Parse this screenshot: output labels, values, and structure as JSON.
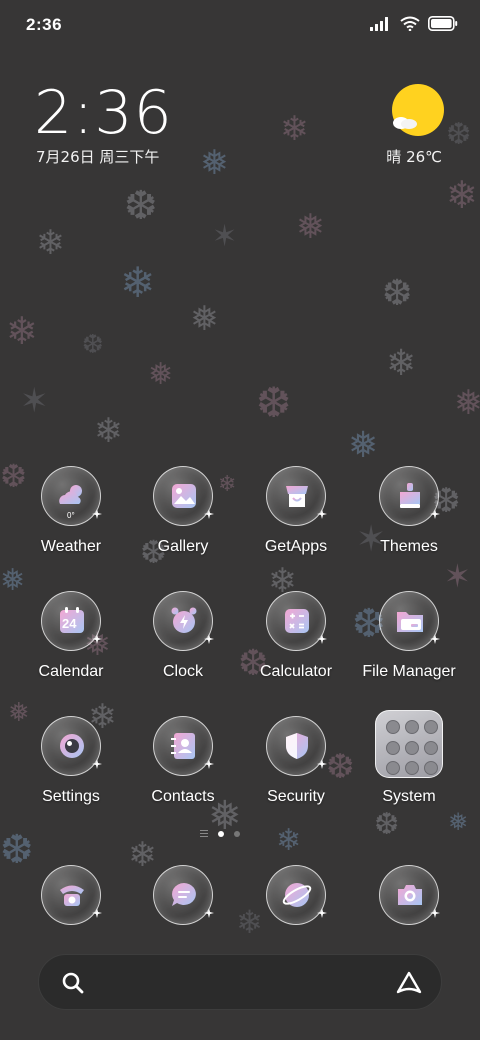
{
  "status": {
    "time": "2:36"
  },
  "widget": {
    "clock": "2:36",
    "date": "7月26日 周三下午",
    "weather": "晴 26℃"
  },
  "apps": [
    {
      "label": "Weather",
      "icon": "weather-icon"
    },
    {
      "label": "Gallery",
      "icon": "gallery-icon"
    },
    {
      "label": "GetApps",
      "icon": "getapps-icon"
    },
    {
      "label": "Themes",
      "icon": "themes-icon"
    },
    {
      "label": "Calendar",
      "icon": "calendar-icon",
      "badge": "24"
    },
    {
      "label": "Clock",
      "icon": "alarm-clock-icon"
    },
    {
      "label": "Calculator",
      "icon": "calculator-icon"
    },
    {
      "label": "File Manager",
      "icon": "folder-icon"
    },
    {
      "label": "Settings",
      "icon": "settings-icon"
    },
    {
      "label": "Contacts",
      "icon": "contacts-icon"
    },
    {
      "label": "Security",
      "icon": "shield-icon"
    },
    {
      "label": "System",
      "icon": "system-folder-icon"
    }
  ],
  "weather_icon_temp": "0°",
  "dock": [
    {
      "name": "phone-icon"
    },
    {
      "name": "messages-icon"
    },
    {
      "name": "browser-icon"
    },
    {
      "name": "camera-icon"
    }
  ],
  "page_indicator": {
    "pages": 2,
    "active": 1
  },
  "colors": {
    "background": "#373636",
    "accent_pink": "#f0a8d0",
    "accent_blue": "#a8c8f0",
    "sun": "#ffd21f"
  }
}
